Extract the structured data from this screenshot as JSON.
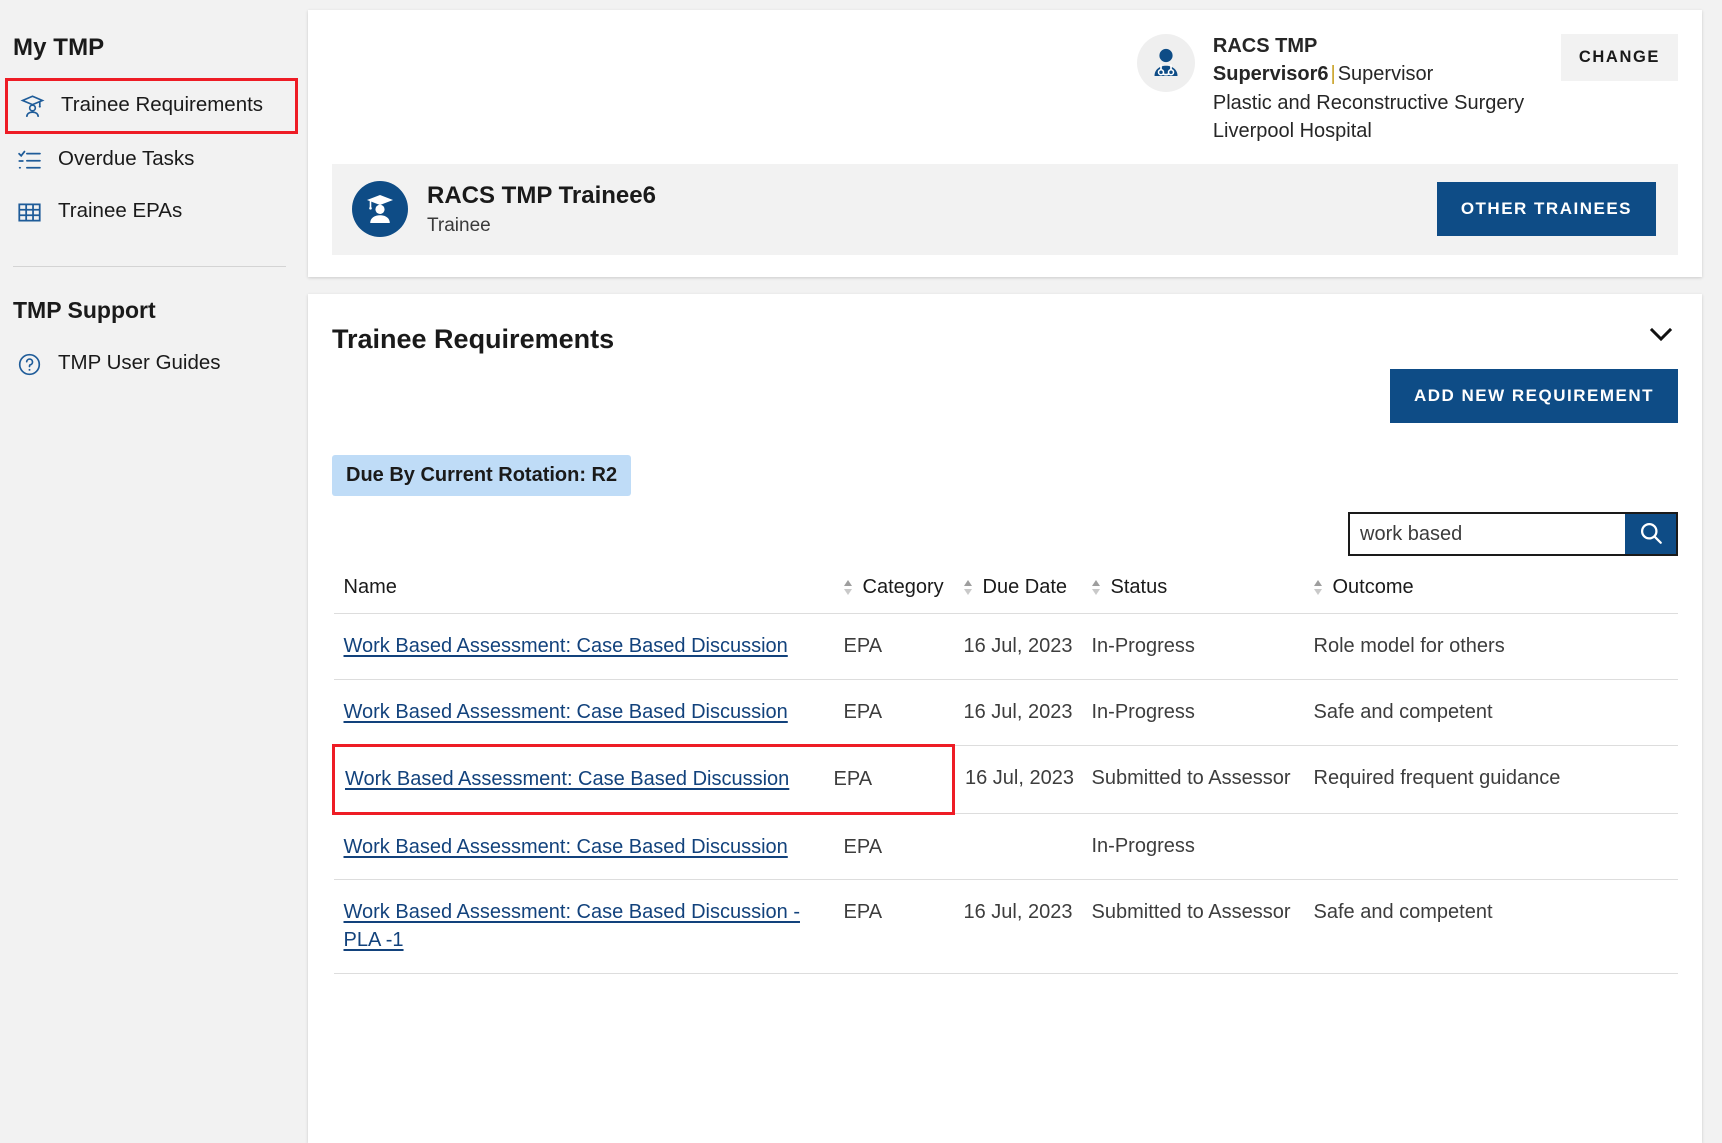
{
  "sidebar": {
    "heading": "My TMP",
    "items": [
      {
        "label": "Trainee Requirements",
        "icon": "graduate-cap-icon",
        "highlighted": true
      },
      {
        "label": "Overdue Tasks",
        "icon": "checklist-icon",
        "highlighted": false
      },
      {
        "label": "Trainee EPAs",
        "icon": "table-grid-icon",
        "highlighted": false
      }
    ],
    "support_heading": "TMP Support",
    "support_items": [
      {
        "label": "TMP User Guides",
        "icon": "question-circle-icon"
      }
    ]
  },
  "header": {
    "supervisor_name": "RACS TMP Supervisor6",
    "supervisor_separator": "|",
    "supervisor_role": "Supervisor",
    "supervisor_specialty": "Plastic and Reconstructive Surgery",
    "supervisor_hospital": "Liverpool Hospital",
    "change_label": "CHANGE",
    "avatar_icon": "doctor-avatar-icon"
  },
  "trainee": {
    "name": "RACS TMP Trainee6",
    "role": "Trainee",
    "other_trainees_label": "OTHER TRAINEES",
    "avatar_icon": "graduate-avatar-icon"
  },
  "requirements": {
    "title": "Trainee Requirements",
    "collapse_icon": "chevron-down-icon",
    "add_button_label": "ADD NEW REQUIREMENT",
    "filter_chip": "Due By Current Rotation:  R2",
    "search": {
      "value": "work based",
      "placeholder": "",
      "icon": "search-icon"
    },
    "columns": [
      {
        "label": "Name",
        "sortable": true
      },
      {
        "label": "Category",
        "sortable": true
      },
      {
        "label": "Due Date",
        "sortable": true
      },
      {
        "label": "Status",
        "sortable": true
      },
      {
        "label": "Outcome",
        "sortable": true
      }
    ],
    "rows": [
      {
        "name": "Work Based Assessment: Case Based Discussion",
        "category": "EPA",
        "due_date": "16 Jul, 2023",
        "status": "In-Progress",
        "outcome": "Role model for others",
        "highlighted": false
      },
      {
        "name": "Work Based Assessment: Case Based Discussion",
        "category": "EPA",
        "due_date": "16 Jul, 2023",
        "status": "In-Progress",
        "outcome": "Safe and competent",
        "highlighted": false
      },
      {
        "name": "Work Based Assessment: Case Based Discussion",
        "category": "EPA",
        "due_date": "16 Jul, 2023",
        "status": "Submitted to Assessor",
        "outcome": "Required frequent guidance",
        "highlighted": true
      },
      {
        "name": "Work Based Assessment: Case Based Discussion",
        "category": "EPA",
        "due_date": "",
        "status": "In-Progress",
        "outcome": "",
        "highlighted": false
      },
      {
        "name": "Work Based Assessment: Case Based Discussion - PLA -1",
        "category": "EPA",
        "due_date": "16 Jul, 2023",
        "status": "Submitted to Assessor",
        "outcome": "Safe and competent",
        "highlighted": false
      }
    ]
  },
  "colors": {
    "brand_blue": "#0e4c86",
    "link_blue": "#12427c",
    "highlight_red": "#ee1c25",
    "chip_blue": "#bfdcf7",
    "panel_gray": "#f2f2f2"
  }
}
